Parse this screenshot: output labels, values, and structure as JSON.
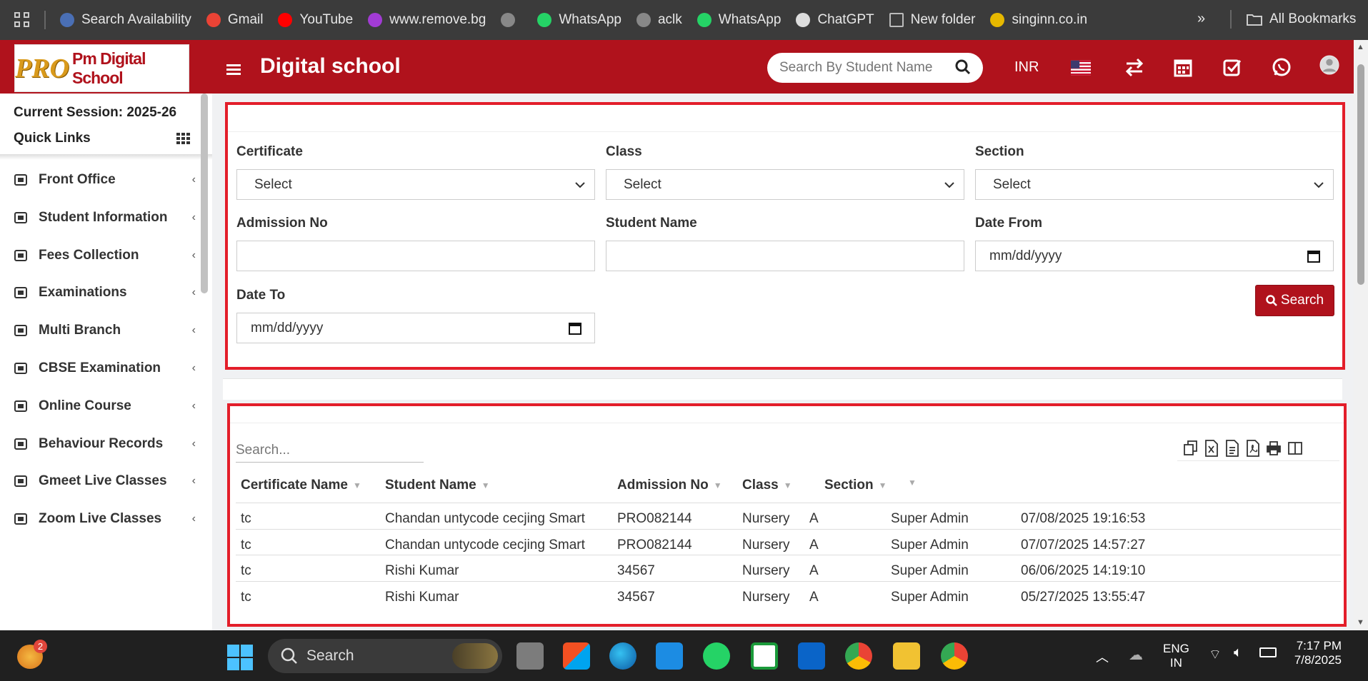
{
  "bookmarks": [
    {
      "label": "Search Availability",
      "icon": "app-icon",
      "color": "#4a6fb5"
    },
    {
      "label": "Gmail",
      "icon": "gmail-icon",
      "color": "#ea4335"
    },
    {
      "label": "YouTube",
      "icon": "youtube-icon",
      "color": "#ff0000"
    },
    {
      "label": "www.remove.bg",
      "icon": "removebg-icon",
      "color": "#a23bd4"
    },
    {
      "label": "",
      "icon": "globe-icon",
      "color": "#888888"
    },
    {
      "label": "WhatsApp",
      "icon": "whatsapp-icon",
      "color": "#25d366"
    },
    {
      "label": "aclk",
      "icon": "globe-icon",
      "color": "#888888"
    },
    {
      "label": "WhatsApp",
      "icon": "whatsapp-icon",
      "color": "#25d366"
    },
    {
      "label": "ChatGPT",
      "icon": "chatgpt-icon",
      "color": "#dddddd"
    },
    {
      "label": "New folder",
      "icon": "folder-icon",
      "color": "#bbbbbb"
    },
    {
      "label": "singinn.co.in",
      "icon": "singinn-icon",
      "color": "#e6b800"
    }
  ],
  "all_bookmarks": "All Bookmarks",
  "header": {
    "logo_pro": "PRO",
    "logo_name": "Pm Digital School",
    "title": "Digital school",
    "search_placeholder": "Search By Student Name",
    "currency": "INR",
    "accent": "#b0121c"
  },
  "sidebar": {
    "session": "Current Session: 2025-26",
    "quick_links": "Quick Links",
    "items": [
      {
        "label": "Front Office",
        "icon": "front-office-icon"
      },
      {
        "label": "Student Information",
        "icon": "user-plus-icon"
      },
      {
        "label": "Fees Collection",
        "icon": "money-icon"
      },
      {
        "label": "Examinations",
        "icon": "map-icon"
      },
      {
        "label": "Multi Branch",
        "icon": "sitemap-icon"
      },
      {
        "label": "CBSE Examination",
        "icon": "document-icon"
      },
      {
        "label": "Online Course",
        "icon": "file-video-icon"
      },
      {
        "label": "Behaviour Records",
        "icon": "signpost-icon"
      },
      {
        "label": "Gmeet Live Classes",
        "icon": "video-icon"
      },
      {
        "label": "Zoom Live Classes",
        "icon": "video-icon"
      }
    ]
  },
  "filters": {
    "certificate": {
      "label": "Certificate",
      "value": "Select"
    },
    "class": {
      "label": "Class",
      "value": "Select"
    },
    "section": {
      "label": "Section",
      "value": "Select"
    },
    "admission_no": {
      "label": "Admission No",
      "value": ""
    },
    "student_name": {
      "label": "Student Name",
      "value": ""
    },
    "date_from": {
      "label": "Date From",
      "value": "mm/dd/yyyy"
    },
    "date_to": {
      "label": "Date To",
      "value": "mm/dd/yyyy"
    },
    "search_button": "Search"
  },
  "table": {
    "search_placeholder": "Search...",
    "columns": [
      "Certificate Name",
      "Student Name",
      "Admission No",
      "Class",
      "Section",
      ""
    ],
    "rows": [
      {
        "certificate": "tc",
        "student": "Chandan untycode cecjing Smart",
        "admission": "PRO082144",
        "class": "Nursery",
        "section": "A",
        "by": "Super Admin",
        "date": "07/08/2025 19:16:53"
      },
      {
        "certificate": "tc",
        "student": "Chandan untycode cecjing Smart",
        "admission": "PRO082144",
        "class": "Nursery",
        "section": "A",
        "by": "Super Admin",
        "date": "07/07/2025 14:57:27"
      },
      {
        "certificate": "tc",
        "student": "Rishi Kumar",
        "admission": "34567",
        "class": "Nursery",
        "section": "A",
        "by": "Super Admin",
        "date": "06/06/2025 14:19:10"
      },
      {
        "certificate": "tc",
        "student": "Rishi Kumar",
        "admission": "34567",
        "class": "Nursery",
        "section": "A",
        "by": "Super Admin",
        "date": "05/27/2025 13:55:47"
      }
    ]
  },
  "taskbar": {
    "search": "Search",
    "badge": "2",
    "lang1": "ENG",
    "lang2": "IN",
    "time": "7:17 PM",
    "date": "7/8/2025"
  }
}
